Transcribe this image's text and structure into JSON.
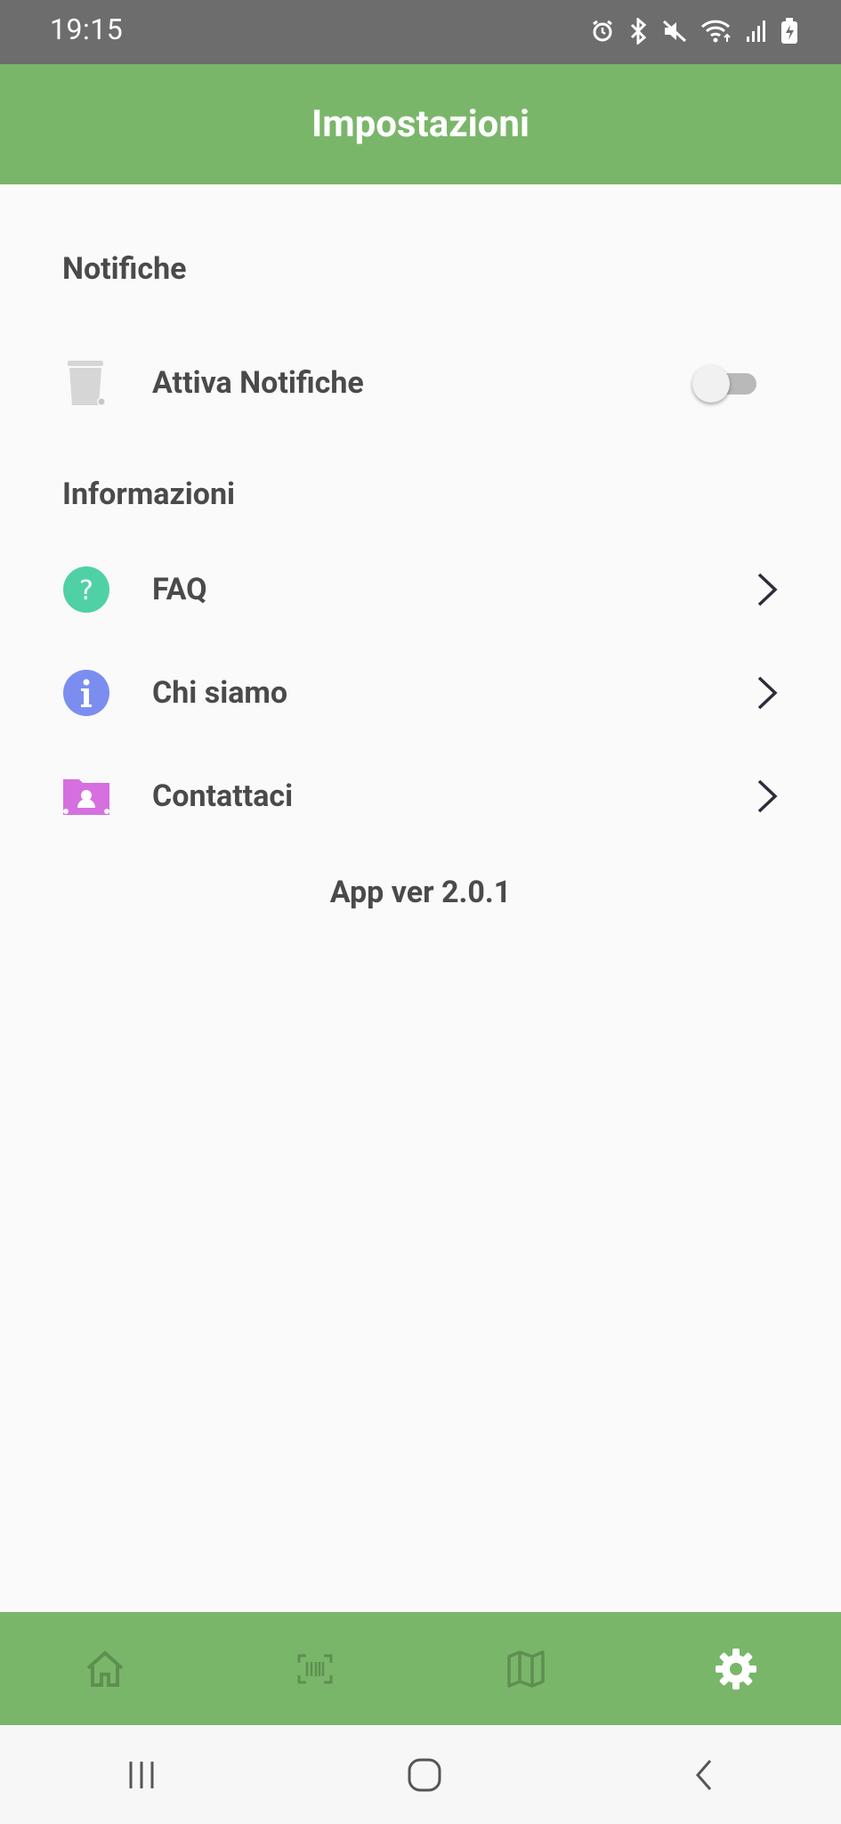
{
  "status_bar": {
    "time": "19:15",
    "icons": [
      "alarm-icon",
      "bluetooth-icon",
      "mute-icon",
      "wifi-icon",
      "signal-icon",
      "battery-icon"
    ]
  },
  "header": {
    "title": "Impostazioni"
  },
  "sections": {
    "notifications": {
      "title": "Notifiche",
      "items": [
        {
          "label": "Attiva Notifiche",
          "icon": "trash-bin-icon",
          "toggle_on": false
        }
      ]
    },
    "info": {
      "title": "Informazioni",
      "items": [
        {
          "label": "FAQ",
          "icon": "question-icon",
          "color": "#4fd1a5"
        },
        {
          "label": "Chi siamo",
          "icon": "info-icon",
          "color": "#7b8ef0"
        },
        {
          "label": "Contattaci",
          "icon": "contact-folder-icon",
          "color": "#d66fe0"
        }
      ]
    }
  },
  "version": "App ver 2.0.1",
  "bottom_nav": {
    "items": [
      "home-icon",
      "barcode-scan-icon",
      "map-icon",
      "settings-gear-icon"
    ],
    "active": "settings-gear-icon"
  },
  "colors": {
    "primary": "#7ab66a",
    "status_bar": "#6d6d6d"
  }
}
